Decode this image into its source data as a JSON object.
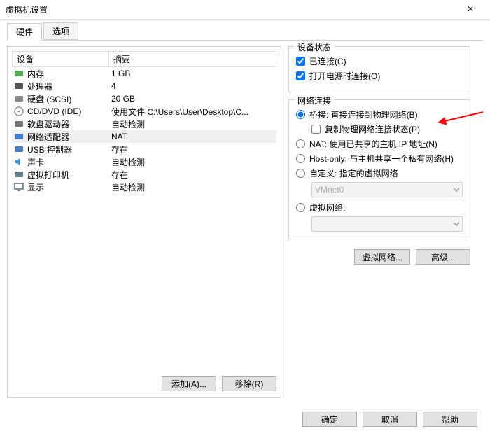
{
  "window": {
    "title": "虚拟机设置"
  },
  "tabs": {
    "hardware": "硬件",
    "options": "选项"
  },
  "table": {
    "headers": {
      "device": "设备",
      "summary": "摘要"
    },
    "rows": [
      {
        "device": "内存",
        "summary": "1 GB",
        "icon": "memory"
      },
      {
        "device": "处理器",
        "summary": "4",
        "icon": "cpu"
      },
      {
        "device": "硬盘 (SCSI)",
        "summary": "20 GB",
        "icon": "disk"
      },
      {
        "device": "CD/DVD (IDE)",
        "summary": "使用文件 C:\\Users\\User\\Desktop\\C...",
        "icon": "cd"
      },
      {
        "device": "软盘驱动器",
        "summary": "自动检测",
        "icon": "floppy"
      },
      {
        "device": "网络适配器",
        "summary": "NAT",
        "icon": "net",
        "selected": true
      },
      {
        "device": "USB 控制器",
        "summary": "存在",
        "icon": "usb"
      },
      {
        "device": "声卡",
        "summary": "自动检测",
        "icon": "sound"
      },
      {
        "device": "虚拟打印机",
        "summary": "存在",
        "icon": "printer"
      },
      {
        "device": "显示",
        "summary": "自动检测",
        "icon": "display"
      }
    ]
  },
  "leftButtons": {
    "add": "添加(A)...",
    "remove": "移除(R)"
  },
  "deviceStatus": {
    "title": "设备状态",
    "connected": "已连接(C)",
    "connectAtPowerOn": "打开电源时连接(O)"
  },
  "networkConn": {
    "title": "网络连接",
    "bridged": "桥接: 直接连接到物理网络(B)",
    "replicate": "复制物理网络连接状态(P)",
    "nat": "NAT: 使用已共享的主机 IP 地址(N)",
    "hostOnly": "Host-only: 与主机共享一个私有网络(H)",
    "custom": "自定义: 指定的虚拟网络",
    "vmnet": "VMnet0",
    "virtualNet": "虚拟网络:"
  },
  "rightButtons": {
    "virtualNet": "虚拟网络...",
    "advanced": "高级..."
  },
  "footer": {
    "ok": "确定",
    "cancel": "取消",
    "help": "帮助"
  }
}
